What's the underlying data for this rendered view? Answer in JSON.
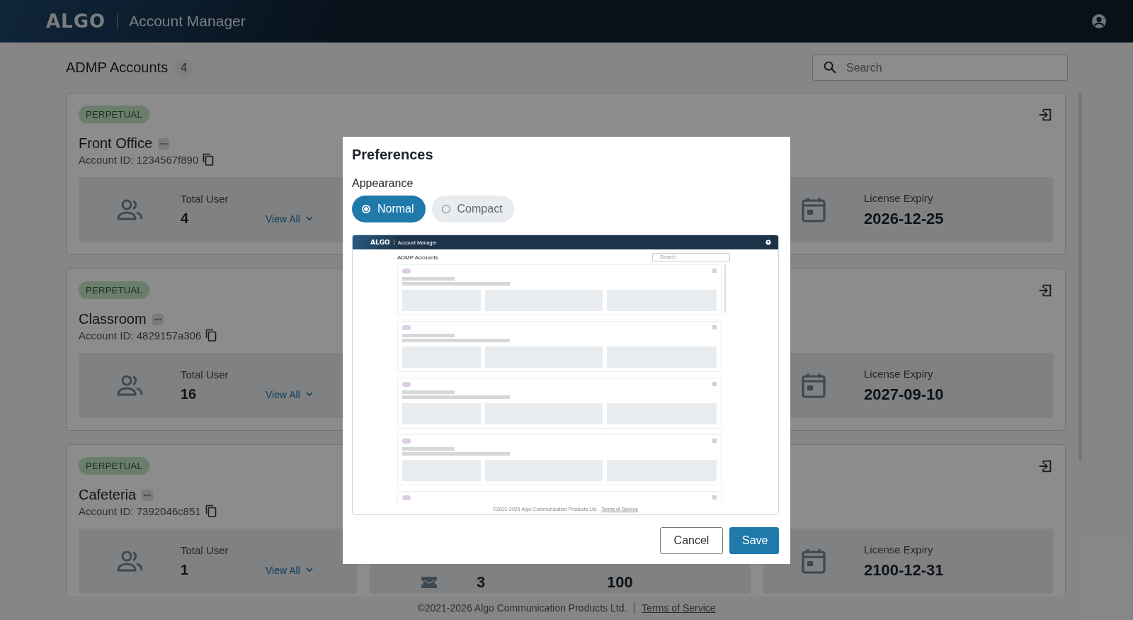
{
  "header": {
    "logo": "ALGO",
    "title": "Account Manager"
  },
  "page": {
    "title": "ADMP Accounts",
    "count": "4",
    "search": {
      "placeholder": "Search"
    }
  },
  "accounts": [
    {
      "license": "PERPETUAL",
      "name": "Front Office",
      "account_id": "Account ID: 1234567f890",
      "users_label": "Total User",
      "users": "4",
      "view_all": "View All",
      "expiry_label": "License Expiry",
      "expiry": "2026-12-25"
    },
    {
      "license": "PERPETUAL",
      "name": "Classroom",
      "account_id": "Account ID: 4829157a306",
      "users_label": "Total User",
      "users": "16",
      "view_all": "View All",
      "expiry_label": "License Expiry",
      "expiry": "2027-09-10"
    },
    {
      "license": "PERPETUAL",
      "name": "Cafeteria",
      "account_id": "Account ID: 7392046c851",
      "users_label": "Total User",
      "users": "1",
      "view_all": "View All",
      "middle_values": [
        "3",
        "100"
      ],
      "expiry_label": "License Expiry",
      "expiry": "2100-12-31"
    }
  ],
  "footer": {
    "copyright": "©2021-2026 Algo Communication Products Ltd.",
    "terms": "Terms of Service"
  },
  "dialog": {
    "title": "Preferences",
    "section": "Appearance",
    "options": [
      {
        "label": "Normal",
        "selected": true
      },
      {
        "label": "Compact",
        "selected": false
      }
    ],
    "preview": {
      "logo": "ALGO",
      "title": "Account Manager",
      "page_title": "ADMP Accounts",
      "search_placeholder": "Search",
      "copyright": "©2021-2025 Algo Communication Products Ltd.",
      "terms": "Terms of Service"
    },
    "buttons": [
      {
        "label": "Cancel",
        "kind": "secondary"
      },
      {
        "label": "Save",
        "kind": "primary"
      }
    ]
  }
}
